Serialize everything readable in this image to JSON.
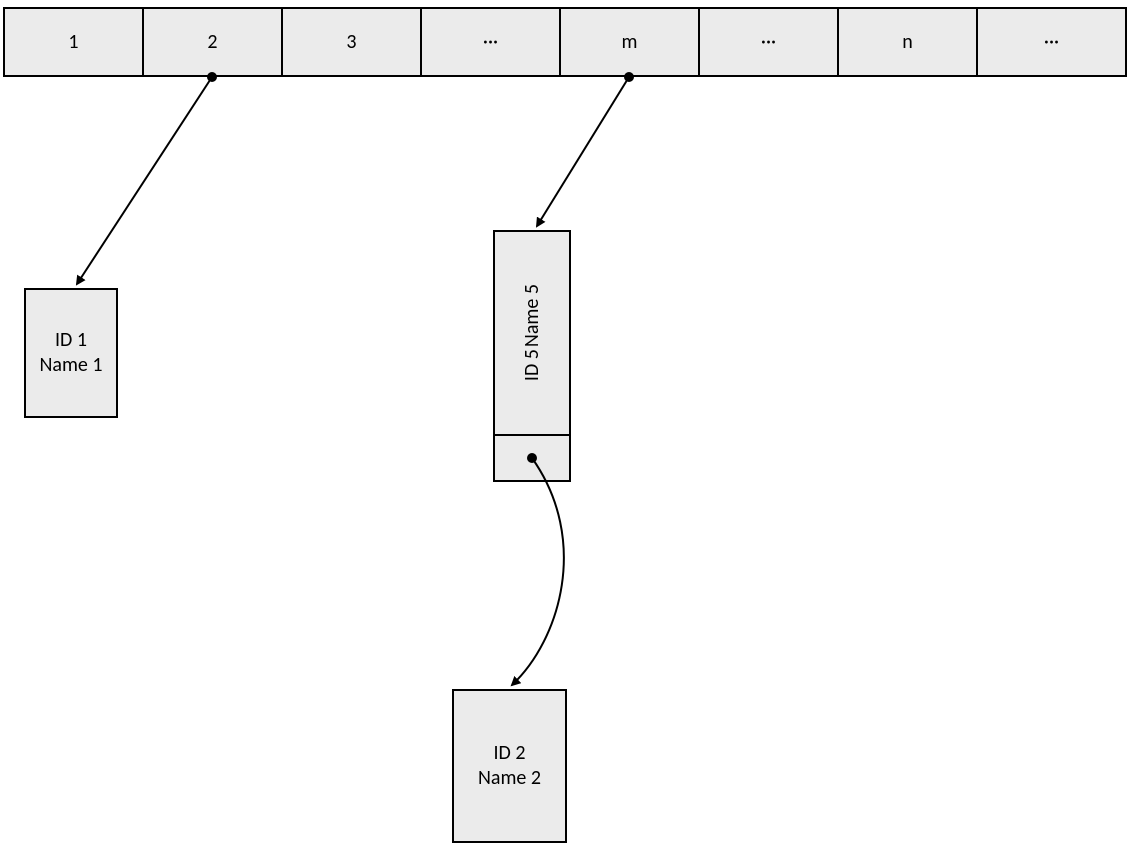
{
  "array": {
    "cells": [
      "1",
      "2",
      "3",
      "···",
      "m",
      "···",
      "n",
      "···"
    ]
  },
  "node1": {
    "id_line": "ID 1",
    "name_line": "Name 1"
  },
  "node5": {
    "id_line": "ID 5",
    "name_line": "Name 5"
  },
  "node2": {
    "id_line": "ID 2",
    "name_line": "Name 2"
  },
  "colors": {
    "cell_bg": "#ebebeb",
    "border": "#000000"
  }
}
